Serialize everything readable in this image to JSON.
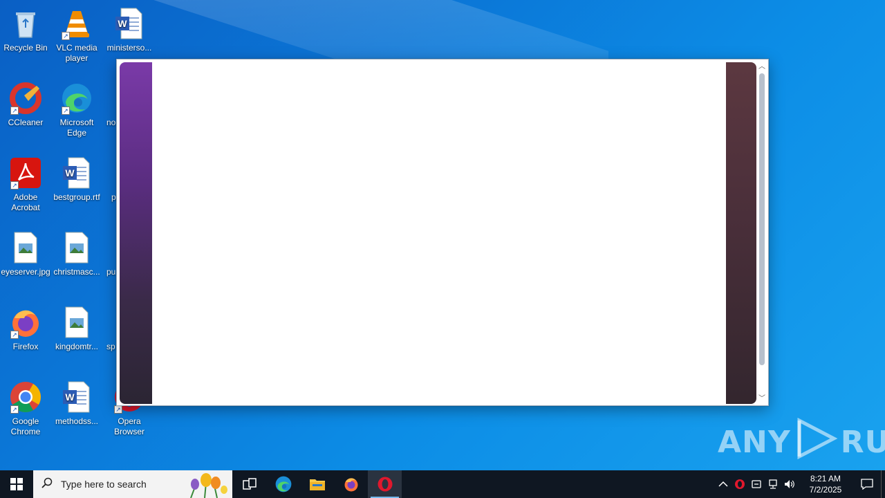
{
  "desktop": {
    "icons": [
      {
        "label": "Recycle Bin",
        "icon": "recycle-bin-icon"
      },
      {
        "label": "VLC media player",
        "icon": "vlc-icon"
      },
      {
        "label": "ministerso...",
        "icon": "word-doc-icon"
      },
      {
        "label": "CCleaner",
        "icon": "ccleaner-icon"
      },
      {
        "label": "Microsoft Edge",
        "icon": "edge-icon"
      },
      {
        "label": "no",
        "icon": "partial-icon"
      },
      {
        "label": "Adobe Acrobat",
        "icon": "acrobat-icon"
      },
      {
        "label": "bestgroup.rtf",
        "icon": "word-doc-icon"
      },
      {
        "label": "p",
        "icon": "partial-icon"
      },
      {
        "label": "eyeserver.jpg",
        "icon": "image-file-icon"
      },
      {
        "label": "christmasc...",
        "icon": "image-file-icon"
      },
      {
        "label": "pu",
        "icon": "partial-icon"
      },
      {
        "label": "Firefox",
        "icon": "firefox-icon"
      },
      {
        "label": "kingdomtr...",
        "icon": "image-file-icon"
      },
      {
        "label": "sp",
        "icon": "partial-icon"
      },
      {
        "label": "Google Chrome",
        "icon": "chrome-icon"
      },
      {
        "label": "methodss...",
        "icon": "word-doc-icon"
      },
      {
        "label": "Opera Browser",
        "icon": "opera-icon"
      }
    ]
  },
  "watermark": {
    "left": "ANY",
    "right": "RUN"
  },
  "taskbar": {
    "search_placeholder": "Type here to search",
    "clock_time": "8:21 AM",
    "clock_date": "7/2/2025"
  },
  "colors": {
    "accent": "#76b9ed",
    "taskbar": "#0f1722",
    "popup_left": "#7a3aa8",
    "popup_right": "#5c3840"
  }
}
